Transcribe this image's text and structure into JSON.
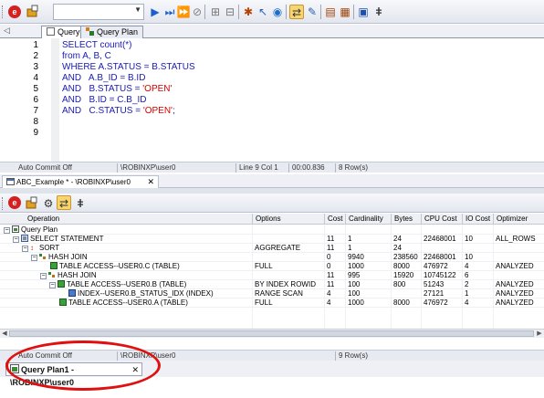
{
  "toolbar": {
    "buttons": [
      "close-icon",
      "edit-icon",
      "dropdown-arrow-icon",
      "play-icon",
      "step-icon",
      "step-all-icon",
      "stop-icon",
      "commit-icon",
      "rollback-icon",
      "debug-icon",
      "pointer-icon",
      "network-icon",
      "explain-plan-icon",
      "pen-icon",
      "script-icon",
      "list-icon",
      "ab-icon"
    ]
  },
  "tabs": [
    {
      "label": "Query",
      "active": true
    },
    {
      "label": "Query Plan",
      "active": false
    }
  ],
  "editor": {
    "lines": [
      {
        "num": "1",
        "html": "SELECT count(*)"
      },
      {
        "num": "2",
        "html": "from A, B, C"
      },
      {
        "num": "3",
        "html": "WHERE A.STATUS = B.STATUS"
      },
      {
        "num": "4",
        "html": "AND   A.B_ID = B.ID"
      },
      {
        "num": "5",
        "pre": "AND   B.STATUS = ",
        "str": "'OPEN'",
        "post": ""
      },
      {
        "num": "6",
        "html": "AND   B.ID = C.B_ID"
      },
      {
        "num": "7",
        "pre": "AND   C.STATUS = ",
        "str": "'OPEN'",
        "post": ";"
      },
      {
        "num": "8",
        "html": ""
      },
      {
        "num": "9",
        "html": ""
      }
    ]
  },
  "status1": {
    "autocommit": "Auto Commit Off",
    "conn": "\\ROBINXP\\user0",
    "pos": "Line 9 Col 1",
    "time": "00:00.836",
    "rows": "8 Row(s)"
  },
  "doctab": {
    "label": "ABC_Example * - \\ROBINXP\\user0",
    "close": "✕"
  },
  "grid": {
    "headers": [
      "Operation",
      "Options",
      "Cost",
      "Cardinality",
      "Bytes",
      "CPU Cost",
      "IO Cost",
      "Optimizer"
    ],
    "rows": [
      {
        "op": "Query Plan",
        "indent": 0,
        "exp": "−",
        "icon": "plan",
        "opt": "",
        "cost": "",
        "card": "",
        "bytes": "",
        "cpu": "",
        "io": "",
        "optz": ""
      },
      {
        "op": "SELECT STATEMENT",
        "indent": 1,
        "exp": "−",
        "icon": "select",
        "opt": "",
        "cost": "11",
        "card": "1",
        "bytes": "24",
        "cpu": "22468001",
        "io": "10",
        "optz": "ALL_ROWS"
      },
      {
        "op": "SORT",
        "indent": 2,
        "exp": "−",
        "icon": "sort",
        "opt": "AGGREGATE",
        "cost": "11",
        "card": "1",
        "bytes": "24",
        "cpu": "",
        "io": "",
        "optz": ""
      },
      {
        "op": "HASH JOIN",
        "indent": 3,
        "exp": "−",
        "icon": "join",
        "opt": "",
        "cost": "0",
        "card": "9940",
        "bytes": "238560",
        "cpu": "22468001",
        "io": "10",
        "optz": ""
      },
      {
        "op": "TABLE ACCESS--USER0.C (TABLE)",
        "indent": 4,
        "exp": "",
        "icon": "table",
        "opt": "FULL",
        "cost": "0",
        "card": "1000",
        "bytes": "8000",
        "cpu": "476972",
        "io": "4",
        "optz": "ANALYZED"
      },
      {
        "op": "HASH JOIN",
        "indent": 4,
        "exp": "−",
        "icon": "join",
        "opt": "",
        "cost": "11",
        "card": "995",
        "bytes": "15920",
        "cpu": "10745122",
        "io": "6",
        "optz": ""
      },
      {
        "op": "TABLE ACCESS--USER0.B (TABLE)",
        "indent": 5,
        "exp": "−",
        "icon": "table",
        "opt": "BY INDEX ROWID",
        "cost": "11",
        "card": "100",
        "bytes": "800",
        "cpu": "51243",
        "io": "2",
        "optz": "ANALYZED"
      },
      {
        "op": "INDEX--USER0.B_STATUS_IDX (INDEX)",
        "indent": 6,
        "exp": "",
        "icon": "index",
        "opt": "RANGE SCAN",
        "cost": "4",
        "card": "100",
        "bytes": "",
        "cpu": "27121",
        "io": "1",
        "optz": "ANALYZED"
      },
      {
        "op": "TABLE ACCESS--USER0.A (TABLE)",
        "indent": 5,
        "exp": "",
        "icon": "table",
        "opt": "FULL",
        "cost": "4",
        "card": "1000",
        "bytes": "8000",
        "cpu": "476972",
        "io": "4",
        "optz": "ANALYZED"
      }
    ]
  },
  "status2": {
    "autocommit": "Auto Commit Off",
    "conn": "\\ROBINXP\\user0",
    "rows": "9 Row(s)"
  },
  "bottom_tab": {
    "label": "Query Plan1 - \\ROBINXP\\user0",
    "close": "✕"
  },
  "colors": {
    "highlight_ellipse": "#e01010",
    "keyword": "#1a1ab4",
    "string": "#d40000"
  }
}
